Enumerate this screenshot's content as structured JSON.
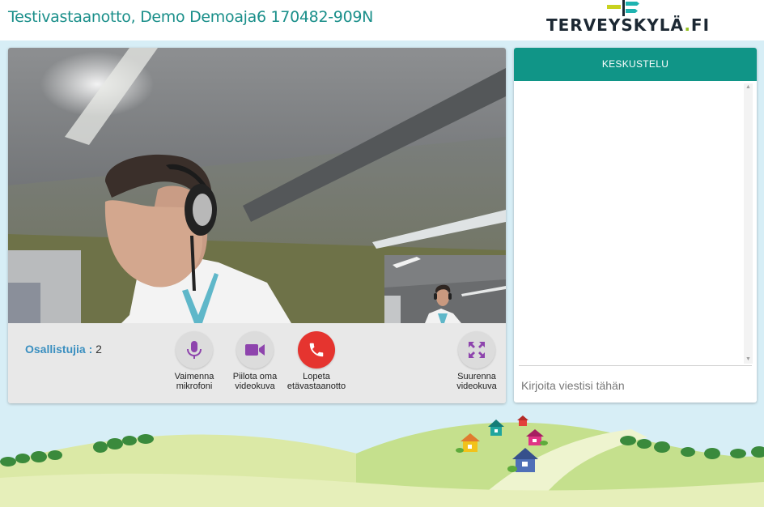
{
  "header": {
    "title": "Testivastaanotto, Demo Demoaja6 170482-909N",
    "logo_text": "TERVEYSKYLÄ",
    "logo_dot": ".",
    "logo_suffix": "FI"
  },
  "video": {
    "participants_label": "Osallistujia :",
    "participants_count": "2",
    "controls": [
      {
        "label": "Vaimenna\nmikrofoni",
        "icon": "microphone-icon"
      },
      {
        "label": "Piilota oma\nvideokuva",
        "icon": "video-camera-icon"
      },
      {
        "label": "Lopeta\netävastaanotto",
        "icon": "phone-hangup-icon"
      },
      {
        "label": "Suurenna\nvideokuva",
        "icon": "expand-icon"
      }
    ]
  },
  "chat": {
    "header": "KESKUSTELU",
    "input_placeholder": "Kirjoita viestisi tähän"
  },
  "colors": {
    "brand_teal": "#109587",
    "title_teal": "#1a8f8a",
    "icon_purple": "#8e44ad",
    "hangup_red": "#e5342f",
    "participants_blue": "#3a8fc0"
  }
}
